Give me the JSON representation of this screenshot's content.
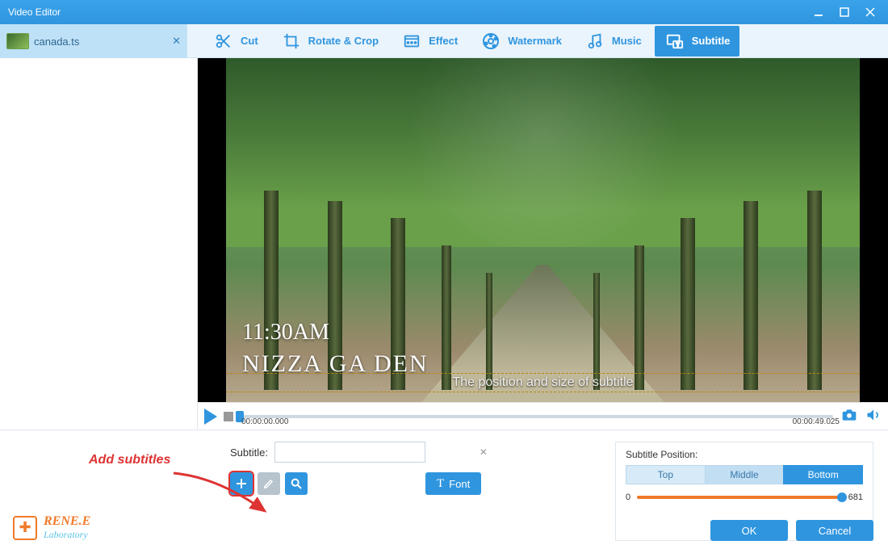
{
  "window": {
    "title": "Video Editor"
  },
  "file_tab": {
    "name": "canada.ts"
  },
  "tabs": {
    "cut": "Cut",
    "rotate_crop": "Rotate & Crop",
    "effect": "Effect",
    "watermark": "Watermark",
    "music": "Music",
    "subtitle": "Subtitle"
  },
  "overlay": {
    "time": "11:30AM",
    "title": "NIZZA GA  DEN",
    "subtitle_guide": "The position and size of subtitle"
  },
  "transport": {
    "current": "00:00:00.000",
    "duration": "00:00:49.025"
  },
  "annotation": "Add subtitles",
  "brand": {
    "line1": "RENE.E",
    "line2": "Laboratory"
  },
  "subtitle_panel": {
    "label": "Subtitle:",
    "font_btn": "Font"
  },
  "position_panel": {
    "label": "Subtitle Position:",
    "top": "Top",
    "middle": "Middle",
    "bottom": "Bottom",
    "slider_min": "0",
    "slider_max": "681"
  },
  "footer": {
    "ok": "OK",
    "cancel": "Cancel"
  }
}
